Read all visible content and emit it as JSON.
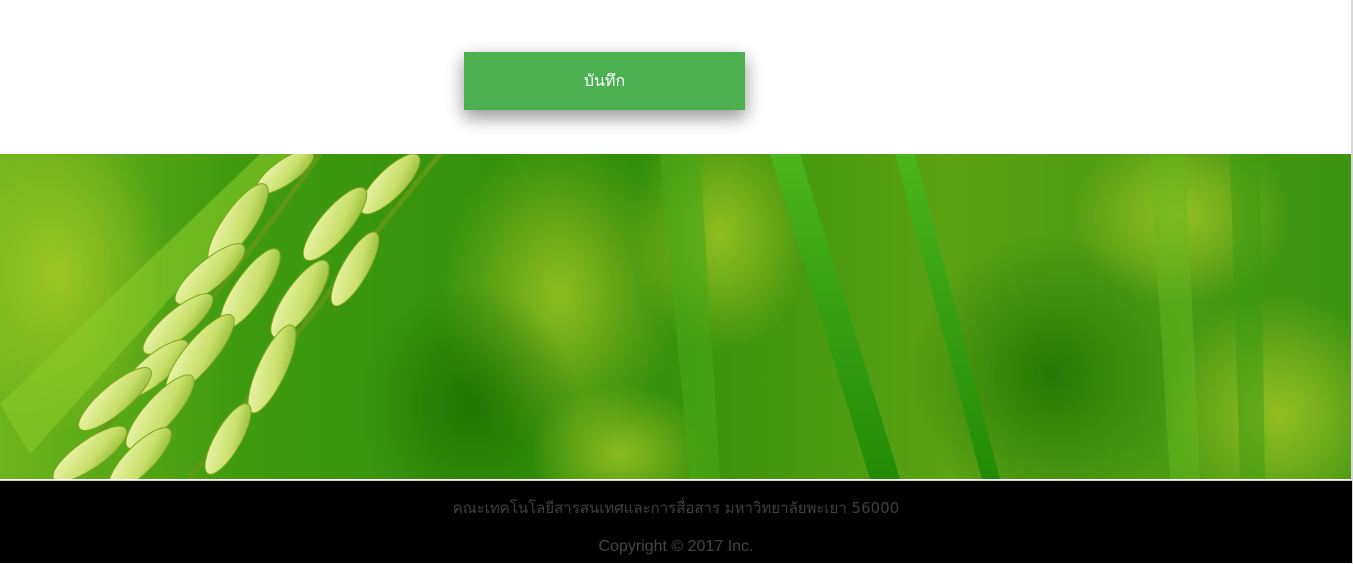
{
  "form": {
    "save_label": "บันทึก"
  },
  "banner": {
    "image_name": "rice-field-banner"
  },
  "footer": {
    "address": "คณะเทคโนโลยีสารสนเทศและการสื่อสาร มหาวิทยาลัยพะเยา 56000",
    "copyright": "Copyright © 2017 Inc."
  },
  "colors": {
    "button_bg": "#4caf50",
    "button_text": "#ffffff",
    "footer_bg": "#000000",
    "footer_text": "#444444",
    "banner_green": "#2f8f0a"
  }
}
